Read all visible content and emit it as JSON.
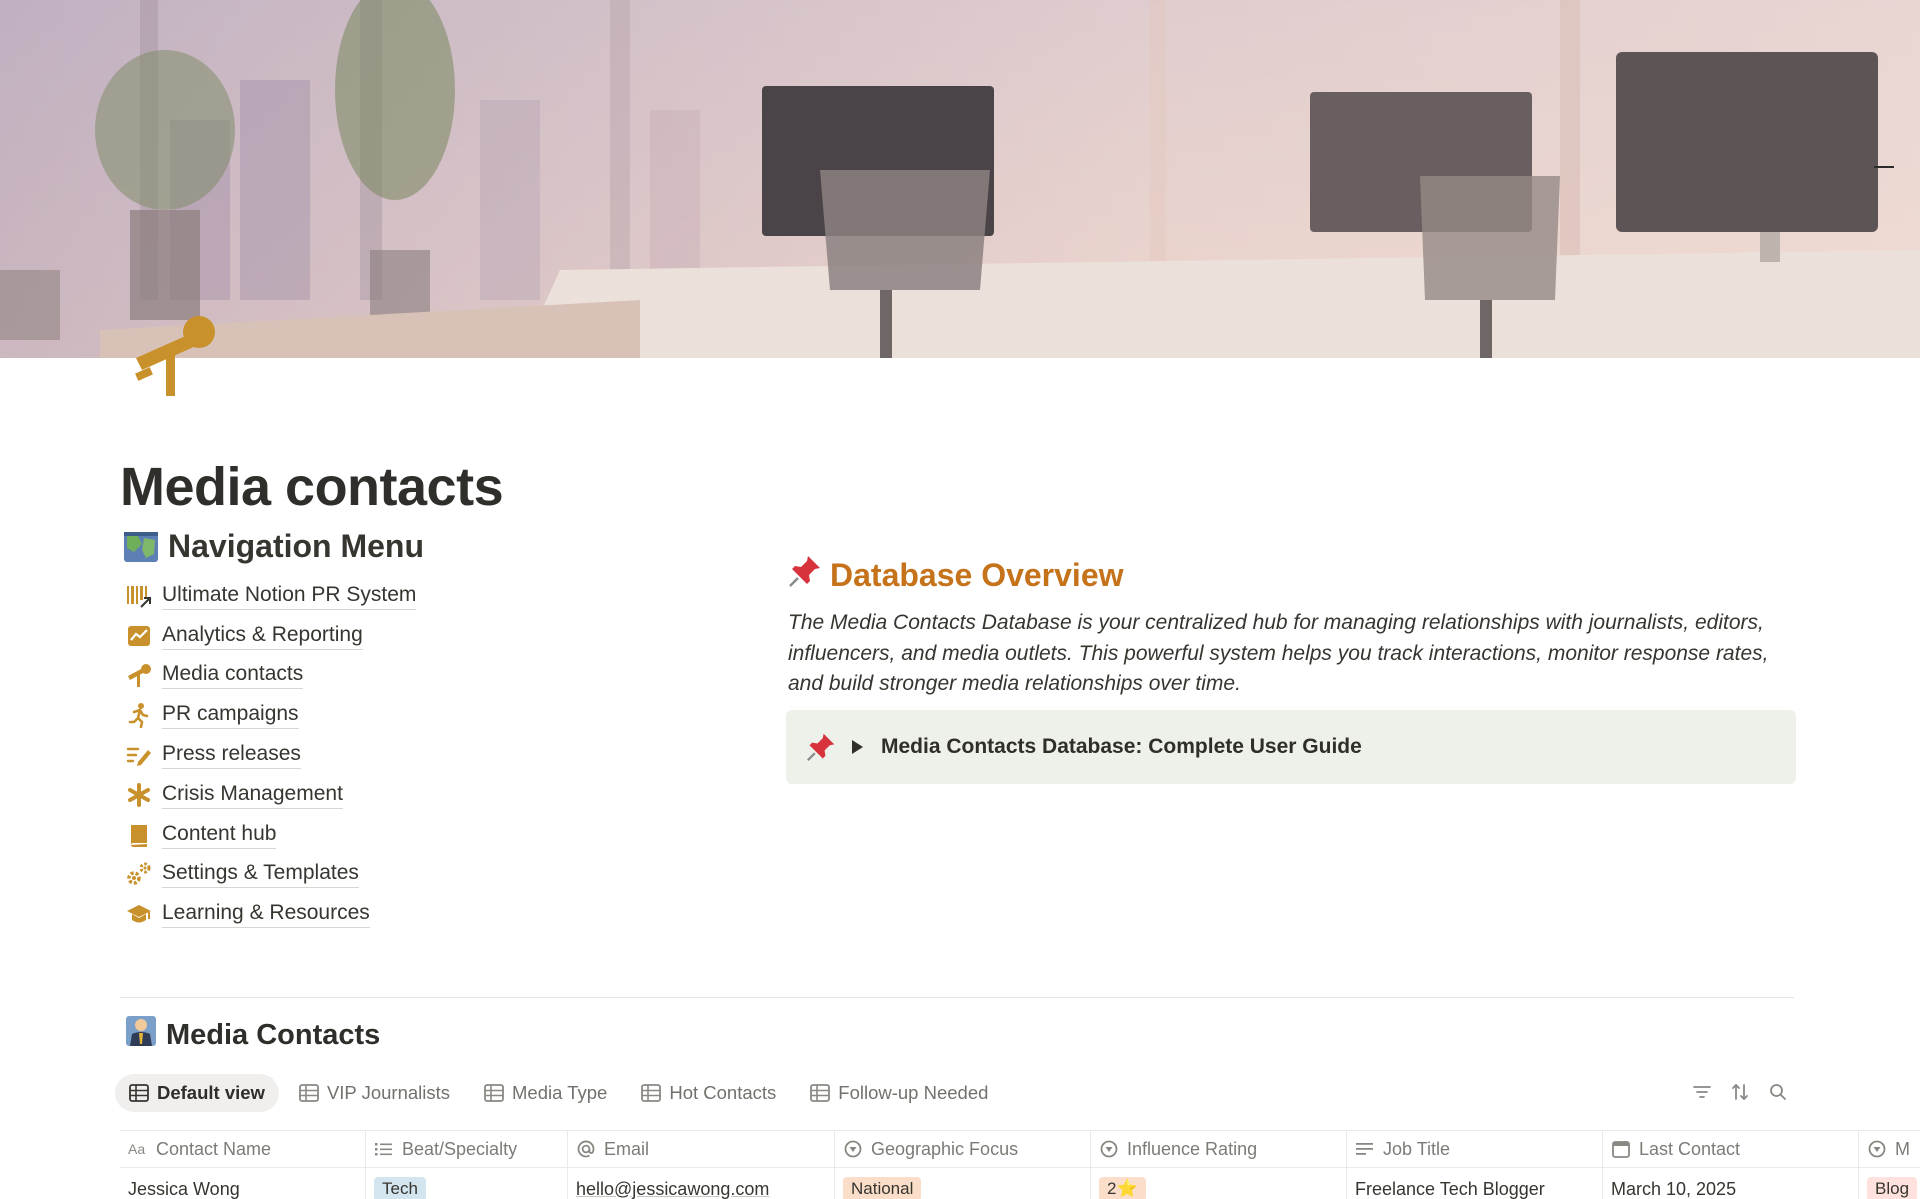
{
  "page": {
    "title": "Media contacts",
    "icon": "microphone-icon"
  },
  "navigation": {
    "heading": "Navigation Menu",
    "heading_icon": "map-emoji-icon",
    "items": [
      {
        "label": "Ultimate Notion PR System",
        "icon": "barcode-arrow-icon"
      },
      {
        "label": "Analytics & Reporting",
        "icon": "chart-line-icon"
      },
      {
        "label": "Media contacts",
        "icon": "microphone-icon"
      },
      {
        "label": "PR campaigns",
        "icon": "running-person-icon"
      },
      {
        "label": "Press releases",
        "icon": "pen-lines-icon"
      },
      {
        "label": "Crisis Management",
        "icon": "asterisk-icon"
      },
      {
        "label": "Content hub",
        "icon": "book-icon"
      },
      {
        "label": "Settings & Templates",
        "icon": "gears-icon"
      },
      {
        "label": "Learning & Resources",
        "icon": "graduation-cap-icon"
      }
    ],
    "icon_color": "#c8912c"
  },
  "overview": {
    "heading": "Database Overview",
    "heading_color": "#c5721a",
    "text": "The Media Contacts Database is your centralized hub for managing relationships with journalists, editors, influencers, and media outlets. This powerful system helps you track interactions, monitor response rates, and build stronger media relationships over time.",
    "callout": {
      "label": "Media Contacts Database: Complete User Guide",
      "background": "#edf1ea"
    }
  },
  "database": {
    "heading": "Media Contacts",
    "heading_icon": "businessman-emoji-icon",
    "tabs": [
      {
        "label": "Default view",
        "active": true
      },
      {
        "label": "VIP Journalists",
        "active": false
      },
      {
        "label": "Media Type",
        "active": false
      },
      {
        "label": "Hot Contacts",
        "active": false
      },
      {
        "label": "Follow-up Needed",
        "active": false
      }
    ],
    "tools": [
      "filter-icon",
      "sort-icon",
      "search-icon"
    ],
    "columns": [
      {
        "label": "Contact Name",
        "icon": "text-aa-icon"
      },
      {
        "label": "Beat/Specialty",
        "icon": "list-icon"
      },
      {
        "label": "Email",
        "icon": "at-icon"
      },
      {
        "label": "Geographic Focus",
        "icon": "status-icon"
      },
      {
        "label": "Influence Rating",
        "icon": "status-icon"
      },
      {
        "label": "Job Title",
        "icon": "text-lines-icon"
      },
      {
        "label": "Last Contact",
        "icon": "calendar-icon"
      },
      {
        "label": "M",
        "icon": "status-icon"
      }
    ],
    "rows": [
      {
        "contact_name": "Jessica Wong",
        "beat": "Tech",
        "email": "hello@jessicawong.com",
        "geographic_focus": "National",
        "influence_rating": "2⭐",
        "job_title": "Freelance Tech Blogger",
        "last_contact": "March 10, 2025",
        "media": "Blog"
      }
    ]
  }
}
